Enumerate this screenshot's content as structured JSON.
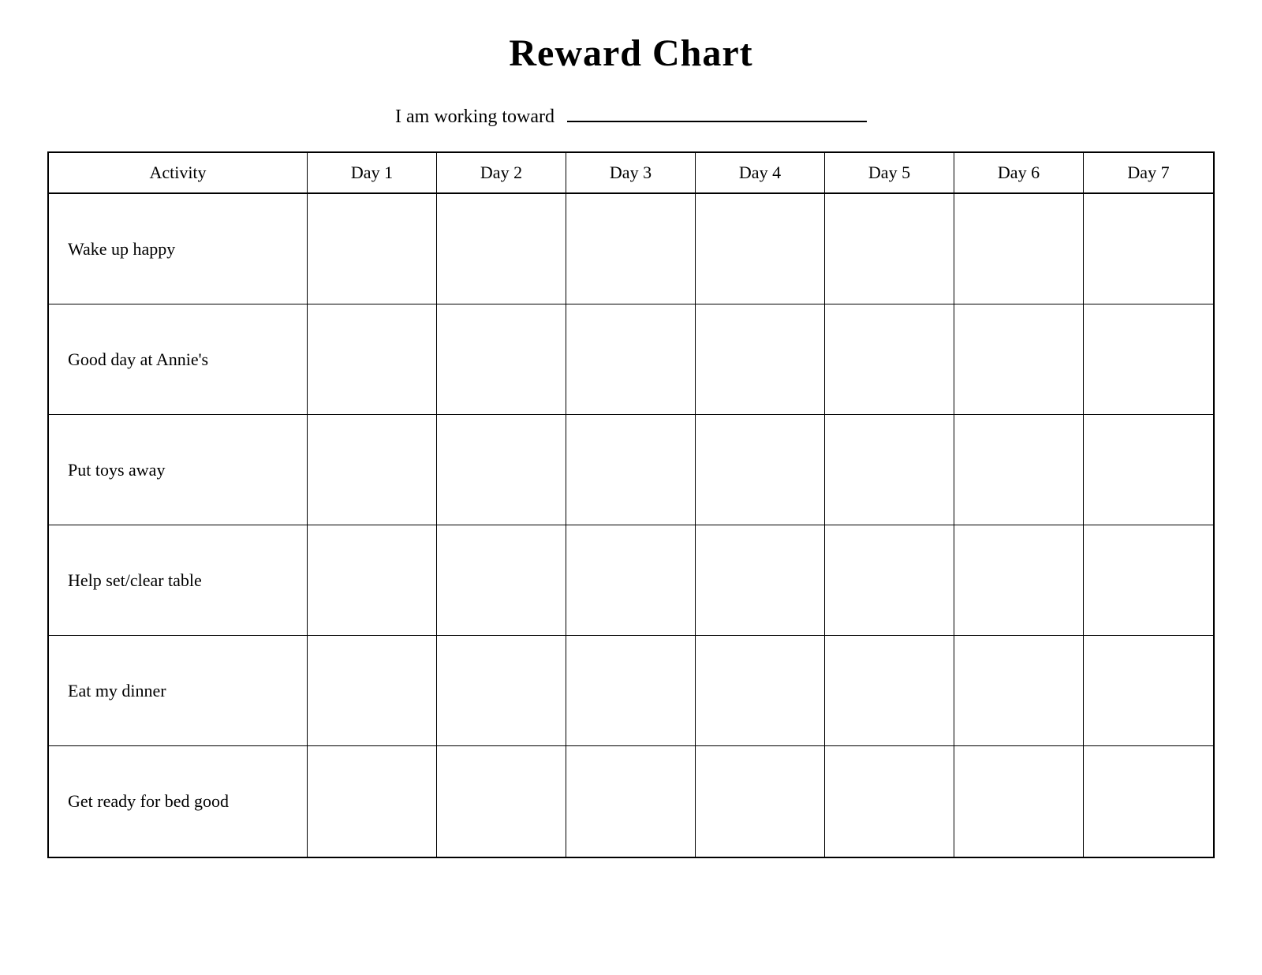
{
  "page": {
    "title": "Reward Chart",
    "subtitle": "I am working toward",
    "columns": {
      "activity": "Activity",
      "days": [
        "Day 1",
        "Day 2",
        "Day 3",
        "Day 4",
        "Day 5",
        "Day 6",
        "Day 7"
      ]
    },
    "rows": [
      {
        "activity": "Wake up happy"
      },
      {
        "activity": "Good day at Annie's"
      },
      {
        "activity": "Put toys away"
      },
      {
        "activity": "Help set/clear table"
      },
      {
        "activity": "Eat my dinner"
      },
      {
        "activity": "Get ready for bed good"
      }
    ]
  }
}
